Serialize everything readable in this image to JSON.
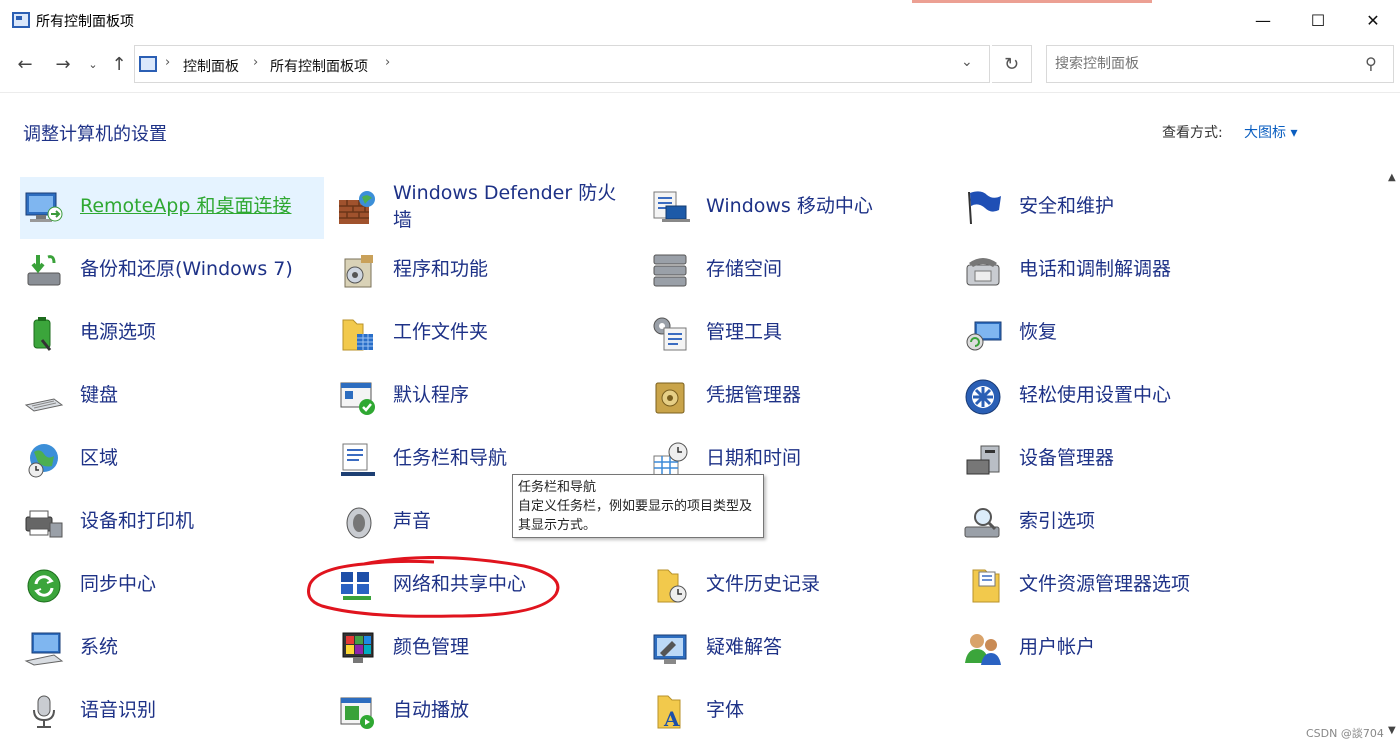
{
  "window": {
    "title": "所有控制面板项",
    "min_glyph": "—",
    "max_glyph": "☐",
    "close_glyph": "✕"
  },
  "nav": {
    "back": "←",
    "forward": "→",
    "recent": "⌄",
    "up": "↑",
    "breadcrumb": [
      "控制面板",
      "所有控制面板项"
    ],
    "separator": "›",
    "dropdown": "⌄",
    "refresh": "↻",
    "search_placeholder": "搜索控制面板",
    "search_glyph": "⚲"
  },
  "header": {
    "title": "调整计算机的设置",
    "view_by_label": "查看方式:",
    "view_by_value": "大图标 ▾"
  },
  "items": [
    {
      "label": "RemoteApp 和桌面连接",
      "icon": "remote-desktop-icon"
    },
    {
      "label": "Windows Defender 防火墙",
      "icon": "firewall-icon"
    },
    {
      "label": "Windows 移动中心",
      "icon": "mobility-center-icon"
    },
    {
      "label": "安全和维护",
      "icon": "security-flag-icon"
    },
    {
      "label": "备份和还原(Windows 7)",
      "icon": "backup-icon"
    },
    {
      "label": "程序和功能",
      "icon": "programs-icon"
    },
    {
      "label": "存储空间",
      "icon": "storage-icon"
    },
    {
      "label": "电话和调制解调器",
      "icon": "phone-modem-icon"
    },
    {
      "label": "电源选项",
      "icon": "power-battery-icon"
    },
    {
      "label": "工作文件夹",
      "icon": "work-folders-icon"
    },
    {
      "label": "管理工具",
      "icon": "admin-tools-icon"
    },
    {
      "label": "恢复",
      "icon": "recovery-icon"
    },
    {
      "label": "键盘",
      "icon": "keyboard-icon"
    },
    {
      "label": "默认程序",
      "icon": "default-programs-icon"
    },
    {
      "label": "凭据管理器",
      "icon": "credential-safe-icon"
    },
    {
      "label": "轻松使用设置中心",
      "icon": "ease-of-access-icon"
    },
    {
      "label": "区域",
      "icon": "globe-clock-icon"
    },
    {
      "label": "任务栏和导航",
      "icon": "taskbar-icon"
    },
    {
      "label": "日期和时间",
      "icon": "calendar-clock-icon"
    },
    {
      "label": "设备管理器",
      "icon": "device-manager-icon"
    },
    {
      "label": "设备和打印机",
      "icon": "printer-icon"
    },
    {
      "label": "声音",
      "icon": "speaker-icon"
    },
    {
      "label": "",
      "icon": ""
    },
    {
      "label": "索引选项",
      "icon": "indexing-icon"
    },
    {
      "label": "同步中心",
      "icon": "sync-icon"
    },
    {
      "label": "网络和共享中心",
      "icon": "network-icon"
    },
    {
      "label": "文件历史记录",
      "icon": "file-history-icon"
    },
    {
      "label": "文件资源管理器选项",
      "icon": "folder-options-icon"
    },
    {
      "label": "系统",
      "icon": "system-monitor-icon"
    },
    {
      "label": "颜色管理",
      "icon": "color-management-icon"
    },
    {
      "label": "疑难解答",
      "icon": "troubleshoot-icon"
    },
    {
      "label": "用户帐户",
      "icon": "user-accounts-icon"
    },
    {
      "label": "语音识别",
      "icon": "microphone-icon"
    },
    {
      "label": "自动播放",
      "icon": "autoplay-icon"
    },
    {
      "label": "字体",
      "icon": "fonts-icon"
    },
    {
      "label": "",
      "icon": ""
    }
  ],
  "tooltip": {
    "title": "任务栏和导航",
    "body": "自定义任务栏，例如要显示的项目类型及其显示方式。"
  },
  "colors": {
    "link_blue": "#1e3287",
    "hover_green": "#2fa832",
    "hover_bg": "#e5f3ff",
    "annotation_red": "#e0141e"
  },
  "watermark": "CSDN @談704"
}
